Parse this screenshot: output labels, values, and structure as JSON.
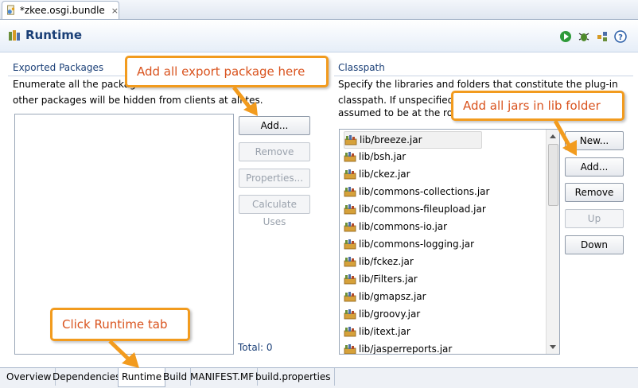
{
  "editor_tab": {
    "title": "*zkee.osgi.bundle",
    "close": "×"
  },
  "header": {
    "title": "Runtime"
  },
  "exported": {
    "title": "Exported Packages",
    "desc_line1": "Enumerate all the packag",
    "desc_line2": "other packages will be hidden from clients at all t",
    "desc_tail": "es.",
    "buttons": {
      "add": "Add...",
      "remove": "Remove",
      "properties": "Properties...",
      "calc": "Calculate Uses"
    },
    "total": "Total: 0"
  },
  "classpath": {
    "title": "Classpath",
    "desc_line1": "Specify the libraries and folders that constitute the plug-in",
    "desc_line2": "classpath.  If unspecified",
    "desc_line3": "assumed to be at the roo",
    "buttons": {
      "new": "New...",
      "add": "Add...",
      "remove": "Remove",
      "up": "Up",
      "down": "Down"
    },
    "items": [
      "lib/breeze.jar",
      "lib/bsh.jar",
      "lib/ckez.jar",
      "lib/commons-collections.jar",
      "lib/commons-fileupload.jar",
      "lib/commons-io.jar",
      "lib/commons-logging.jar",
      "lib/fckez.jar",
      "lib/Filters.jar",
      "lib/gmapsz.jar",
      "lib/groovy.jar",
      "lib/itext.jar",
      "lib/jasperreports.jar"
    ]
  },
  "bottom_tabs": [
    "Overview",
    "Dependencies",
    "Runtime",
    "Build",
    "MANIFEST.MF",
    "build.properties"
  ],
  "callouts": {
    "export": "Add all export package here",
    "jars": "Add all jars in lib folder",
    "runtime": "Click Runtime tab"
  }
}
